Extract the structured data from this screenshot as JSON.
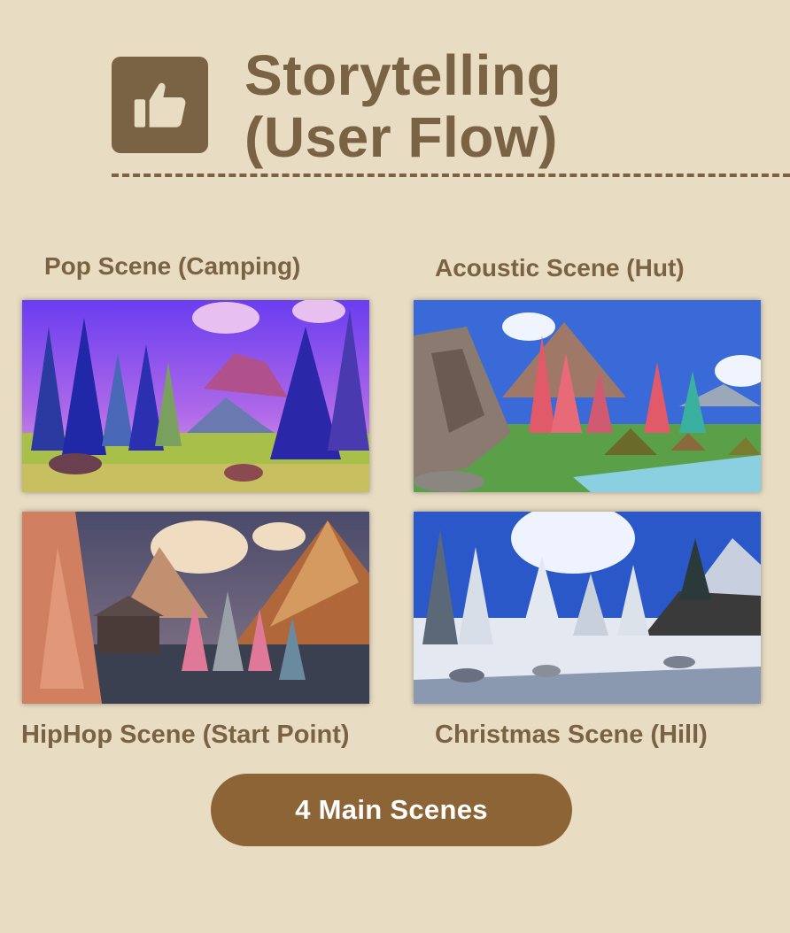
{
  "header": {
    "icon": "thumbs-up-icon",
    "title_line1": "Storytelling",
    "title_line2": "(User Flow)"
  },
  "scenes": [
    {
      "label": "Pop Scene (Camping)"
    },
    {
      "label": "Acoustic Scene (Hut)"
    },
    {
      "label": "HipHop Scene (Start Point)"
    },
    {
      "label": "Christmas Scene (Hill)"
    }
  ],
  "footer": {
    "badge_label": "4 Main Scenes"
  },
  "colors": {
    "background": "#e8dcc3",
    "brand_brown": "#7a6344",
    "pill": "#8c6436"
  }
}
